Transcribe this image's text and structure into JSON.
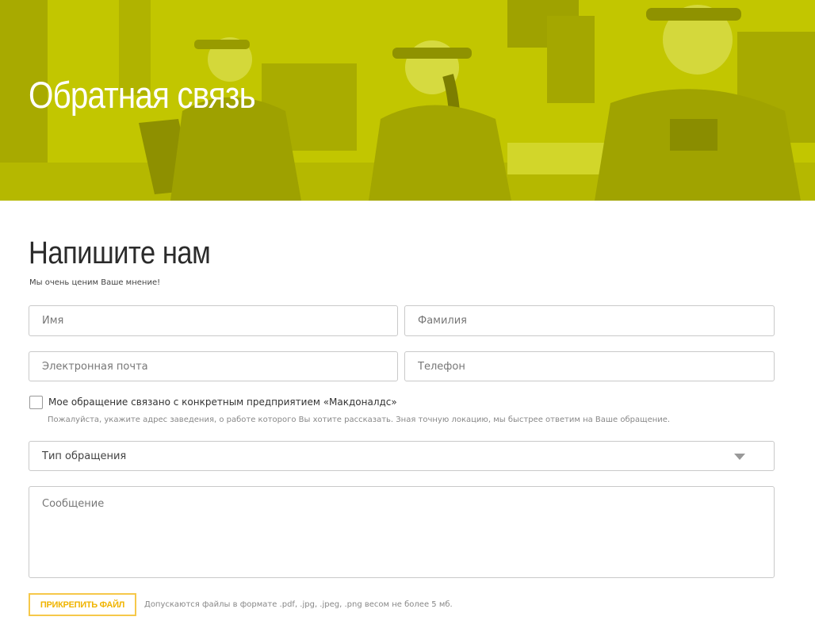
{
  "colors": {
    "hero_tint": "#c4c800",
    "accent": "#f6c84a",
    "accent_text": "#f0b400"
  },
  "hero": {
    "title": "Обратная связь"
  },
  "form": {
    "title": "Напишите нам",
    "subtitle": "Мы очень ценим Ваше мнение!",
    "first_name_placeholder": "Имя",
    "last_name_placeholder": "Фамилия",
    "email_placeholder": "Электронная почта",
    "phone_placeholder": "Телефон",
    "restaurant_checkbox_label": "Мое обращение связано с конкретным предприятием «Макдоналдс»",
    "restaurant_checkbox_checked": false,
    "restaurant_hint": "Пожалуйста, укажите адрес заведения, о работе которого Вы хотите рассказать. Зная точную локацию, мы быстрее ответим на Ваше обращение.",
    "request_type_value": "Тип обращения",
    "message_placeholder": "Сообщение",
    "attach_label": "ПРИКРЕПИТЬ ФАЙЛ",
    "attach_hint": "Допускаются файлы в формате .pdf, .jpg, .jpeg, .png весом не более 5 мб."
  }
}
